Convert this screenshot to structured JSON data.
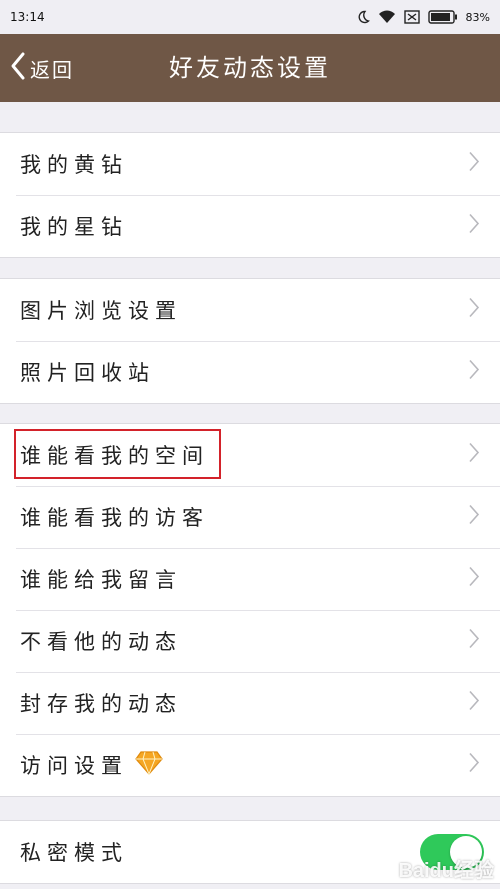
{
  "status_bar": {
    "time": "13:14",
    "battery_percent": "83%",
    "icons": [
      "moon-icon",
      "wifi-icon",
      "sim-off-icon",
      "battery-icon"
    ]
  },
  "nav": {
    "back_label": "返回",
    "title": "好友动态设置"
  },
  "groups": [
    {
      "items": [
        {
          "label": "我的黄钻",
          "icon": "chevron-right-icon"
        },
        {
          "label": "我的星钻",
          "icon": "chevron-right-icon"
        }
      ]
    },
    {
      "items": [
        {
          "label": "图片浏览设置",
          "icon": "chevron-right-icon"
        },
        {
          "label": "照片回收站",
          "icon": "chevron-right-icon"
        }
      ]
    },
    {
      "items": [
        {
          "label": "谁能看我的空间",
          "icon": "chevron-right-icon",
          "highlighted": true
        },
        {
          "label": "谁能看我的访客",
          "icon": "chevron-right-icon"
        },
        {
          "label": "谁能给我留言",
          "icon": "chevron-right-icon"
        },
        {
          "label": "不看他的动态",
          "icon": "chevron-right-icon"
        },
        {
          "label": "封存我的动态",
          "icon": "chevron-right-icon"
        },
        {
          "label": "访问设置",
          "icon": "chevron-right-icon",
          "badge_icon": "diamond-icon"
        }
      ]
    },
    {
      "items": [
        {
          "label": "私密模式",
          "toggle": true
        }
      ]
    }
  ],
  "colors": {
    "nav_background": "#6f5746",
    "page_background": "#f0eff4",
    "highlight_border": "#d3222a",
    "toggle_on": "#2fc95a",
    "diamond": "#f5a623"
  },
  "watermark": "Baidu经验"
}
